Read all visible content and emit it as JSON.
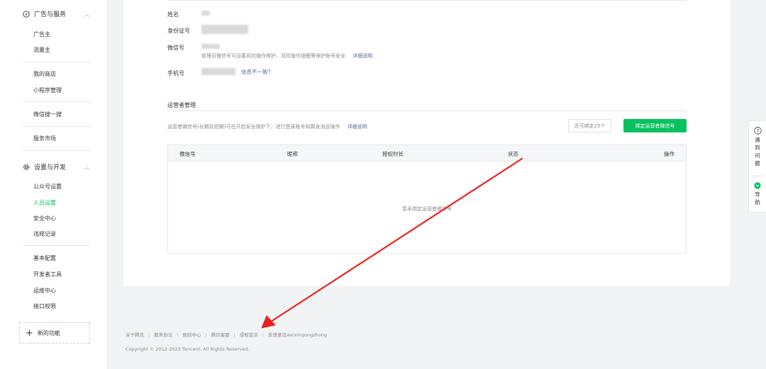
{
  "sidebar": {
    "section_ads": {
      "title": "广告与服务",
      "icon": "compass-icon"
    },
    "ads_items": [
      "广告主",
      "流量主"
    ],
    "shop_items": [
      "我的商店",
      "小程序管理"
    ],
    "search_item": "微信搜一搜",
    "market_item": "服务市场",
    "section_settings": {
      "title": "设置与开发",
      "icon": "gear-icon"
    },
    "settings_items": [
      "公众号设置",
      "人员设置",
      "安全中心",
      "违规记录"
    ],
    "dev_items": [
      "基本配置",
      "开发者工具",
      "运维中心",
      "接口权限"
    ],
    "active_item": "人员设置",
    "new_feature": "新的功能"
  },
  "profile": {
    "name_label": "姓名",
    "id_label": "身份证号",
    "wechat_label": "微信号",
    "wechat_hint": "管理员微信号可设置风险操作保护、风险操作提醒等保护账号安全",
    "detail_link": "详细说明",
    "phone_label": "手机号",
    "phone_mismatch": "信息不一致?"
  },
  "operators": {
    "title": "运营者管理",
    "description": "运营者微信号(长期及短期)可在开启安全保护下，进行登录账号和群发消息操作",
    "detail_link": "详细说明",
    "remaining": "还可绑定25个",
    "bind_button": "绑定运营者微信号",
    "columns": [
      "微信号",
      "昵称",
      "授权时长",
      "状态",
      "操作"
    ],
    "empty_text": "暂未绑定运营者微信号"
  },
  "footer": {
    "links": [
      "关于腾讯",
      "服务协议",
      "规则中心",
      "腾讯客服",
      "侵权投诉",
      "反馈意见weixingongzhong"
    ],
    "copyright": "Copyright © 2012-2023 Tencent. All Rights Reserved."
  },
  "float_panel": {
    "help": "遇到问题",
    "nav": "导航"
  },
  "colors": {
    "accent": "#07c160",
    "link": "#576b95",
    "annotation_arrow": "#e8231f"
  }
}
